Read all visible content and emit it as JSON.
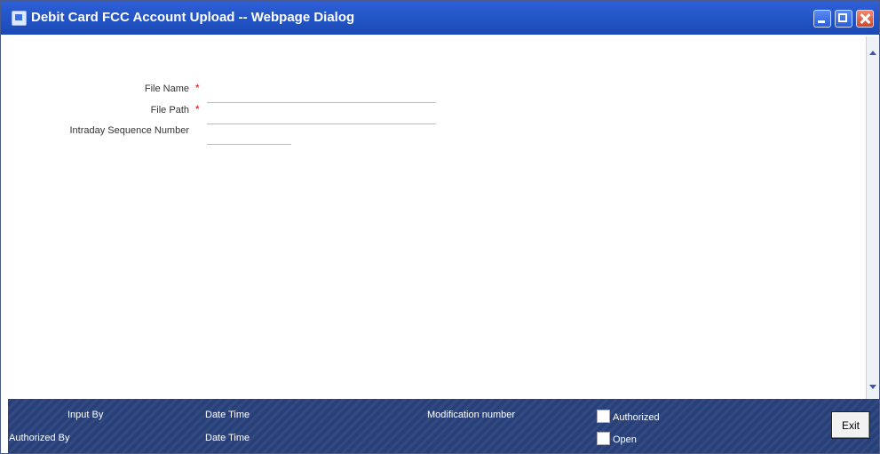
{
  "window": {
    "title": "Debit Card FCC Account Upload -- Webpage Dialog"
  },
  "form": {
    "file_name": {
      "label": "File Name",
      "required_mark": "*",
      "value": ""
    },
    "file_path": {
      "label": "File Path",
      "required_mark": "*",
      "value": ""
    },
    "intraday_sequence": {
      "label": "Intraday Sequence Number",
      "value": ""
    }
  },
  "footer": {
    "input_by_label": "Input By",
    "authorized_by_label": "Authorized By",
    "date_time_label_1": "Date Time",
    "date_time_label_2": "Date Time",
    "modification_number_label": "Modification number",
    "authorized_label": "Authorized",
    "open_label": "Open",
    "exit_label": "Exit"
  }
}
